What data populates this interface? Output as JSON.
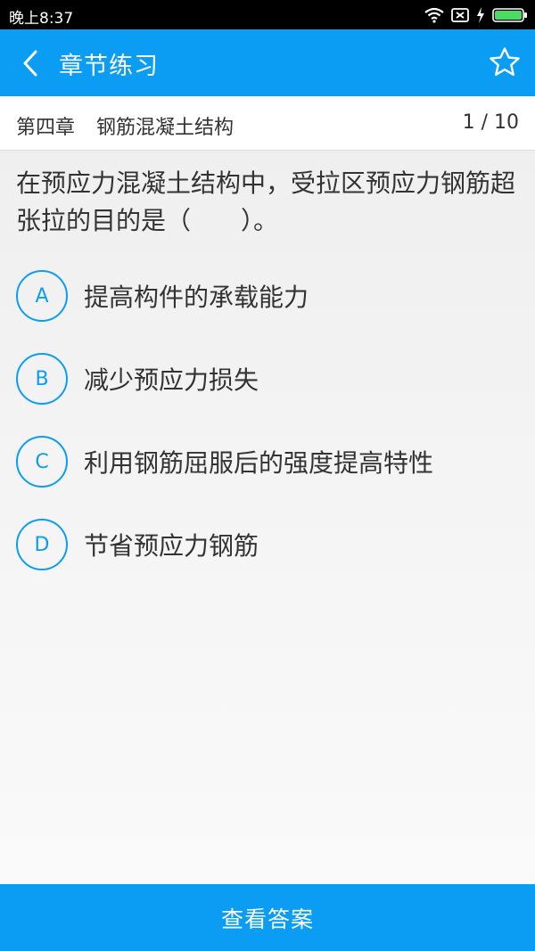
{
  "status_bar": {
    "time": "晚上8:37",
    "icons": [
      "wifi-icon",
      "sim-off-icon",
      "charging-icon",
      "battery-icon"
    ]
  },
  "header": {
    "title": "章节练习",
    "back_icon": "chevron-left-icon",
    "favorite_icon": "star-outline-icon"
  },
  "chapter": {
    "number": "第四章",
    "name": "钢筋混凝土结构",
    "progress": "1 / 10"
  },
  "question": {
    "text": "在预应力混凝土结构中，受拉区预应力钢筋超张拉的目的是（　　）。"
  },
  "options": [
    {
      "letter": "A",
      "text": "提高构件的承载能力"
    },
    {
      "letter": "B",
      "text": "减少预应力损失"
    },
    {
      "letter": "C",
      "text": "利用钢筋屈服后的强度提高特性"
    },
    {
      "letter": "D",
      "text": "节省预应力钢筋"
    }
  ],
  "footer": {
    "button_label": "查看答案"
  },
  "colors": {
    "accent": "#0a9df3",
    "text": "#333333",
    "status_bar": "#000000",
    "battery": "#4cd964"
  }
}
